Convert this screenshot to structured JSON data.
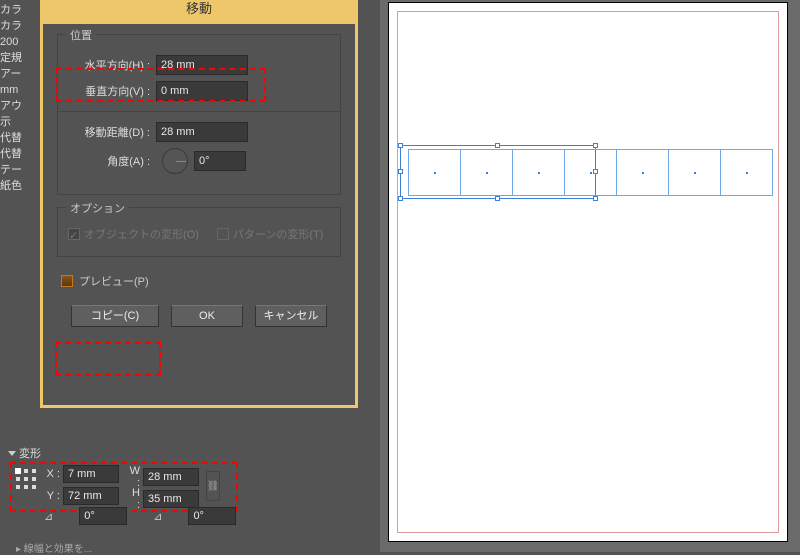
{
  "left_labels": [
    "カラ",
    "カラ",
    "200",
    "定規",
    "アー",
    "mm",
    "アウ",
    "示",
    "代替",
    "代替",
    "テー",
    "紙色"
  ],
  "dialog": {
    "title": "移動",
    "position_group": "位置",
    "horizontal_label": "水平方向(H) :",
    "horizontal_value": "28 mm",
    "vertical_label": "垂直方向(V) :",
    "vertical_value": "0 mm",
    "distance_label": "移動距離(D) :",
    "distance_value": "28 mm",
    "angle_label": "角度(A) :",
    "angle_value": "0°",
    "options_group": "オプション",
    "transform_objects": "オブジェクトの変形(O)",
    "transform_patterns": "パターンの変形(T)",
    "preview_label": "プレビュー(P)",
    "copy_btn": "コピー(C)",
    "ok_btn": "OK",
    "cancel_btn": "キャンセル"
  },
  "transform_panel": {
    "tab": "変形",
    "x_label": "X :",
    "x_value": "7 mm",
    "y_label": "Y :",
    "y_value": "72 mm",
    "w_label": "W :",
    "w_value": "28 mm",
    "h_label": "H :",
    "h_value": "35 mm",
    "shear1_icon": "⊿",
    "shear1_value": "0°",
    "shear2_icon": "⊿",
    "shear2_value": "0°",
    "link_icon": "⛓",
    "foot": "▸ 線幅と効果を..."
  },
  "canvas": {
    "cells": 7
  }
}
